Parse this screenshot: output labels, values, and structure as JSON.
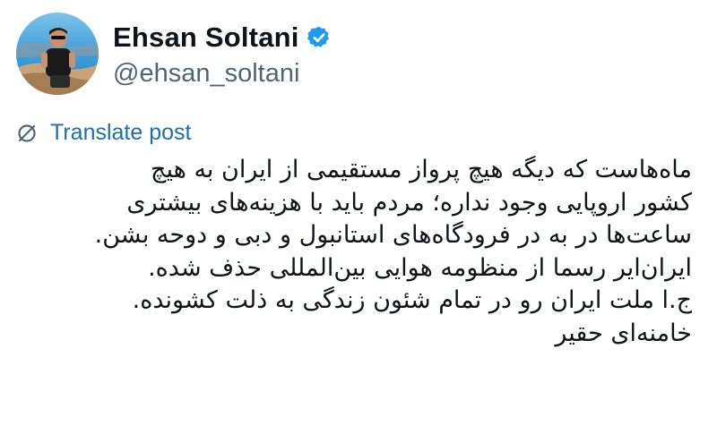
{
  "author": {
    "display_name": "Ehsan Soltani",
    "handle": "@ehsan_soltani",
    "verified": true
  },
  "translate": {
    "label": "Translate post",
    "icon": "translate-icon"
  },
  "post": {
    "direction": "rtl",
    "lines": [
      "ماه‌هاست که دیگه هیچ پرواز مستقیمی از ایران به هیچ",
      "کشور اروپایی وجود نداره؛ مردم باید با هزینه‌های بیشتری",
      "ساعت‌ها در به در فرودگاه‌های استانبول و دبی و دوحه بشن.",
      "ایران‌ایر رسما از منظومه هوایی بین‌المللی حذف شده.",
      "ج.ا ملت ایران رو در تمام شئون زندگی به ذلت کشونده.",
      "خامنه‌ای حقیر"
    ]
  },
  "colors": {
    "text": "#0f1419",
    "secondary": "#536471",
    "link": "#1d6fa5",
    "verified_badge": "#1d9bf0"
  }
}
